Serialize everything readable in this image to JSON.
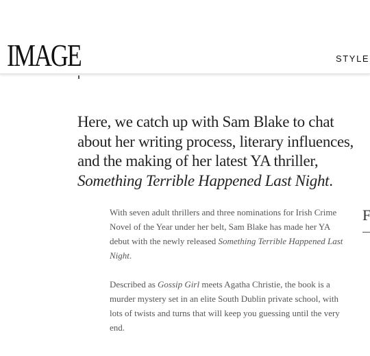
{
  "header": {
    "logo": "IMAGE",
    "nav_item": "STYLE"
  },
  "intro": {
    "line1": "Here, we catch up with Sam Blake to chat",
    "line2": "about her writing process, literary influences,",
    "line3": "and the making of her latest YA thriller,",
    "title": "Something Terrible Happened Last Night",
    "title_end": "."
  },
  "paragraph1": {
    "line1": "With seven adult thrillers and three nominations for Irish Crime",
    "line2": "Novel of the Year under her belt, Sam Blake has made her YA",
    "line3_pre": "debut with the newly released ",
    "line3_title": "Something Terrible Happened Last",
    "line4_title": "Night",
    "line4_end": "."
  },
  "paragraph2": {
    "line1_pre": "Described as ",
    "line1_title": "Gossip Girl",
    "line1_post": " meets Agatha Christie, the book is a",
    "line2": "murder mystery set in an elite South Dublin private school, with",
    "line3": "lots of twists and turns that will keep you guessing until the very",
    "line4": "end."
  },
  "sidebar": {
    "letter": "F"
  }
}
